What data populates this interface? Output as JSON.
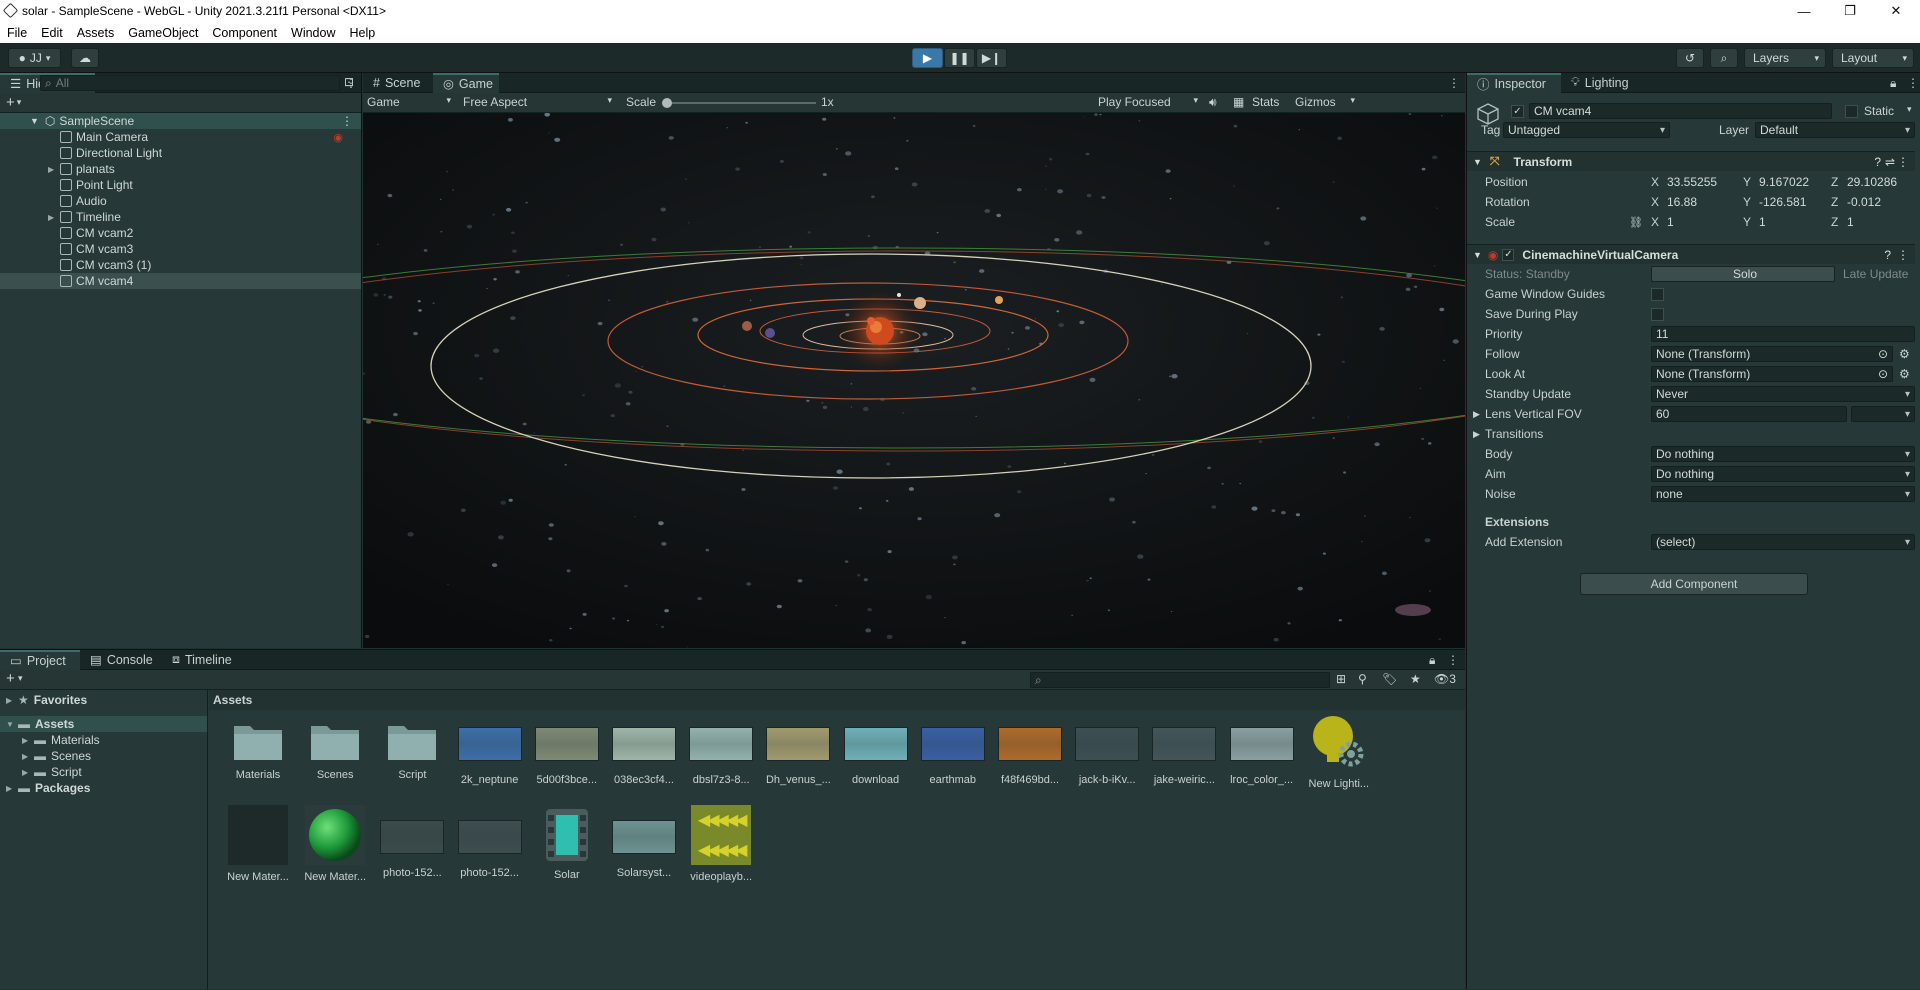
{
  "window": {
    "title": "solar - SampleScene - WebGL - Unity 2021.3.21f1 Personal <DX11>"
  },
  "menu": [
    "File",
    "Edit",
    "Assets",
    "GameObject",
    "Component",
    "Window",
    "Help"
  ],
  "toolbar": {
    "account": "JJ",
    "layers": "Layers",
    "layout": "Layout"
  },
  "hierarchy": {
    "tab": "Hierarchy",
    "search_placeholder": "All",
    "scene": "SampleScene",
    "items": [
      {
        "label": "Main Camera",
        "expandable": false
      },
      {
        "label": "Directional Light",
        "expandable": false
      },
      {
        "label": "planats",
        "expandable": true
      },
      {
        "label": "Point Light",
        "expandable": false
      },
      {
        "label": "Audio",
        "expandable": false
      },
      {
        "label": "Timeline",
        "expandable": true
      },
      {
        "label": "CM vcam2",
        "expandable": false
      },
      {
        "label": "CM vcam3",
        "expandable": false
      },
      {
        "label": "CM vcam3 (1)",
        "expandable": false
      },
      {
        "label": "CM vcam4",
        "expandable": false,
        "selected": true
      }
    ]
  },
  "view_tabs": {
    "scene": "Scene",
    "game": "Game"
  },
  "game_bar": {
    "display": "Game",
    "aspect": "Free Aspect",
    "scale_label": "Scale",
    "scale_value": "1x",
    "play_mode": "Play Focused",
    "stats": "Stats",
    "gizmos": "Gizmos"
  },
  "inspector": {
    "tabs": [
      "Inspector",
      "Lighting"
    ],
    "object_name": "CM vcam4",
    "static_label": "Static",
    "tag_label": "Tag",
    "tag_value": "Untagged",
    "layer_label": "Layer",
    "layer_value": "Default",
    "transform": {
      "title": "Transform",
      "position": {
        "label": "Position",
        "x": "33.55255",
        "y": "9.167022",
        "z": "29.10286"
      },
      "rotation": {
        "label": "Rotation",
        "x": "16.88",
        "y": "-126.581",
        "z": "-0.012"
      },
      "scale": {
        "label": "Scale",
        "x": "1",
        "y": "1",
        "z": "1"
      }
    },
    "cinemachine": {
      "title": "CinemachineVirtualCamera",
      "status": "Status: Standby",
      "solo": "Solo",
      "late_update": "Late Update",
      "game_window_guides": "Game Window Guides",
      "save_during_play": "Save During Play",
      "priority_label": "Priority",
      "priority": "11",
      "follow_label": "Follow",
      "follow": "None (Transform)",
      "lookat_label": "Look At",
      "lookat": "None (Transform)",
      "standby_label": "Standby Update",
      "standby": "Never",
      "fov_label": "Lens Vertical FOV",
      "fov": "60",
      "transitions": "Transitions",
      "body_label": "Body",
      "body": "Do nothing",
      "aim_label": "Aim",
      "aim": "Do nothing",
      "noise_label": "Noise",
      "noise": "none",
      "extensions": "Extensions",
      "add_extension_label": "Add Extension",
      "add_extension": "(select)"
    },
    "add_component": "Add Component"
  },
  "bottom_tabs": [
    "Project",
    "Console",
    "Timeline"
  ],
  "project": {
    "hidden_count": "3",
    "tree": [
      {
        "label": "Favorites",
        "level": 0
      },
      {
        "label": "Assets",
        "level": 0
      },
      {
        "label": "Materials",
        "level": 1
      },
      {
        "label": "Scenes",
        "level": 1
      },
      {
        "label": "Script",
        "level": 1
      },
      {
        "label": "Packages",
        "level": 0
      }
    ],
    "breadcrumb": "Assets",
    "assets": [
      {
        "name": "Materials",
        "kind": "folder"
      },
      {
        "name": "Scenes",
        "kind": "folder"
      },
      {
        "name": "Script",
        "kind": "folder"
      },
      {
        "name": "2k_neptune",
        "kind": "tex",
        "color": "#3d6ea8"
      },
      {
        "name": "5d00f3bce...",
        "kind": "tex",
        "color": "#7e8a74"
      },
      {
        "name": "038ec3cf4...",
        "kind": "tex",
        "color": "#9fb5a8"
      },
      {
        "name": "dbsl7z3-8...",
        "kind": "tex",
        "color": "#93b2ad"
      },
      {
        "name": "Dh_venus_...",
        "kind": "tex",
        "color": "#a29a6e"
      },
      {
        "name": "download",
        "kind": "tex",
        "color": "#6fb0b8"
      },
      {
        "name": "earthmab",
        "kind": "tex",
        "color": "#3a5fa4"
      },
      {
        "name": "f48f469bd...",
        "kind": "tex",
        "color": "#b06a2a"
      },
      {
        "name": "jack-b-iKv...",
        "kind": "tex",
        "color": "#3d4f52"
      },
      {
        "name": "jake-weiric...",
        "kind": "tex",
        "color": "#44555a"
      },
      {
        "name": "lroc_color_...",
        "kind": "tex",
        "color": "#8a9fa0"
      },
      {
        "name": "New Lighti...",
        "kind": "lighting"
      },
      {
        "name": "New Mater...",
        "kind": "dark"
      },
      {
        "name": "New Mater...",
        "kind": "sphere"
      },
      {
        "name": "photo-152...",
        "kind": "tex",
        "color": "#3b4b4c"
      },
      {
        "name": "photo-152...",
        "kind": "tex",
        "color": "#3e4e50"
      },
      {
        "name": "Solar",
        "kind": "timeline"
      },
      {
        "name": "Solarsyst...",
        "kind": "tex",
        "color": "#6e9392"
      },
      {
        "name": "videoplayb...",
        "kind": "video"
      }
    ]
  },
  "colors": {
    "accent": "#3a8fbf",
    "panel": "#263837",
    "dark": "#1b2928"
  }
}
